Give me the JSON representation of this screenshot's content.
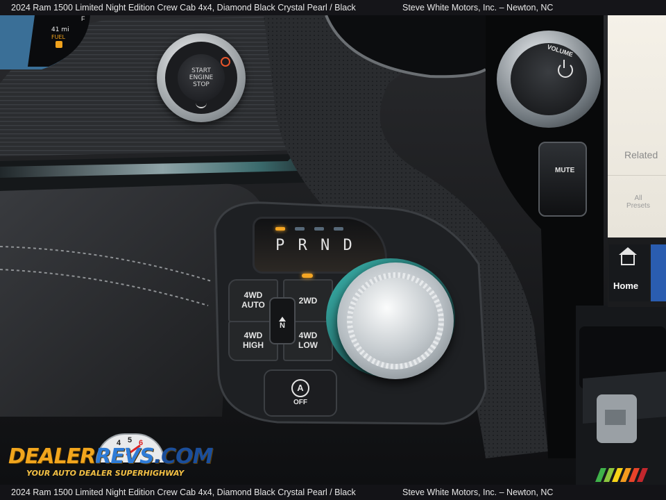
{
  "caption": {
    "left": "2024 Ram 1500 Limited Night Edition Crew Cab 4x4,  Diamond Black Crystal Pearl / Black",
    "right": "Steve White Motors, Inc. – Newton, NC"
  },
  "cluster": {
    "range": "41 mi",
    "fuel_label": "FUEL",
    "gauge_letter": "F"
  },
  "start_button": {
    "line1": "START",
    "line2": "ENGINE",
    "line3": "STOP"
  },
  "gear": {
    "letters": "P R N D"
  },
  "buttons": {
    "four_wd_auto": [
      "4WD",
      "AUTO"
    ],
    "two_wd": "2WD",
    "four_wd_high": [
      "4WD",
      "HIGH"
    ],
    "four_wd_low": [
      "4WD",
      "LOW"
    ],
    "neutral": "N",
    "auto_stop": "OFF",
    "auto_stop_glyph": "A"
  },
  "infotainment": {
    "volume_label": "VOLUME",
    "mute_label": "MUTE",
    "related": "Related",
    "all_presets": [
      "All",
      "Presets"
    ],
    "home": "Home"
  },
  "logo": {
    "part1": "DEALER",
    "part2": "REVS",
    "part3": ".COM",
    "tagline": "YOUR AUTO DEALER SUPERHIGHWAY",
    "gauge_numbers": [
      "4",
      "5",
      "6"
    ]
  },
  "colors": {
    "accent_orange": "#f0a21c",
    "accent_blue": "#2e7bd6",
    "screen_bg": "#f2efe8",
    "teal_trim": "#3bb7b0",
    "gear_indicator": "#f5a623"
  }
}
